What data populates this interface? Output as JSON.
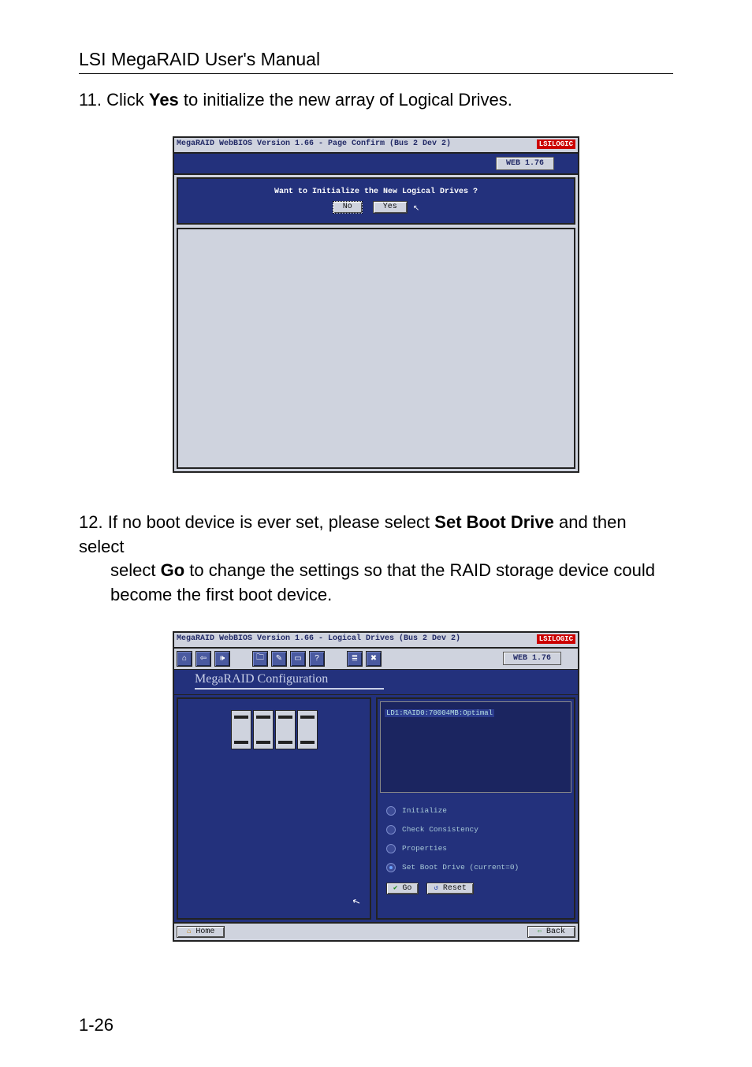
{
  "doc": {
    "header": "LSI MegaRAID User's Manual",
    "step11_num": "11.",
    "step11_a": "Click ",
    "step11_b": "Yes",
    "step11_c": " to initialize the new array of Logical Drives.",
    "step12_num": "12.",
    "step12_a": "If no boot device is ever set, please select ",
    "step12_b": "Set Boot Drive",
    "step12_c": " and then select ",
    "step12_d": "Go",
    "step12_e": " to change the settings so that the RAID storage device could become the first boot device.",
    "page_number": "1-26"
  },
  "shot1": {
    "title": "MegaRAID WebBIOS Version 1.66 - Page Confirm (Bus 2 Dev 2)",
    "logo_lsi": "LSI",
    "logo_logic": "LOGIC",
    "badge": "WEB 1.76",
    "question": "Want to Initialize the New Logical Drives ?",
    "btn_no": "No",
    "btn_yes": "Yes"
  },
  "shot2": {
    "title": "MegaRAID WebBIOS Version 1.66 - Logical Drives (Bus 2 Dev 2)",
    "logo_lsi": "LSI",
    "logo_logic": "LOGIC",
    "badge": "WEB 1.76",
    "config_label": "MegaRAID Configuration",
    "ld_line": "LD1:RAID0:70004MB:Optimal",
    "radios": {
      "init": "Initialize",
      "check": "Check Consistency",
      "props": "Properties",
      "setboot": "Set Boot Drive (current=0)"
    },
    "go": "Go",
    "reset": "Reset",
    "home": "Home",
    "back": "Back"
  },
  "icons": {
    "home": "⌂",
    "back_arrow": "⇦",
    "speaker": "🕪",
    "folder": "🗀",
    "tool": "✎",
    "window": "▭",
    "help": "?",
    "script": "≣",
    "exit": "✖"
  }
}
